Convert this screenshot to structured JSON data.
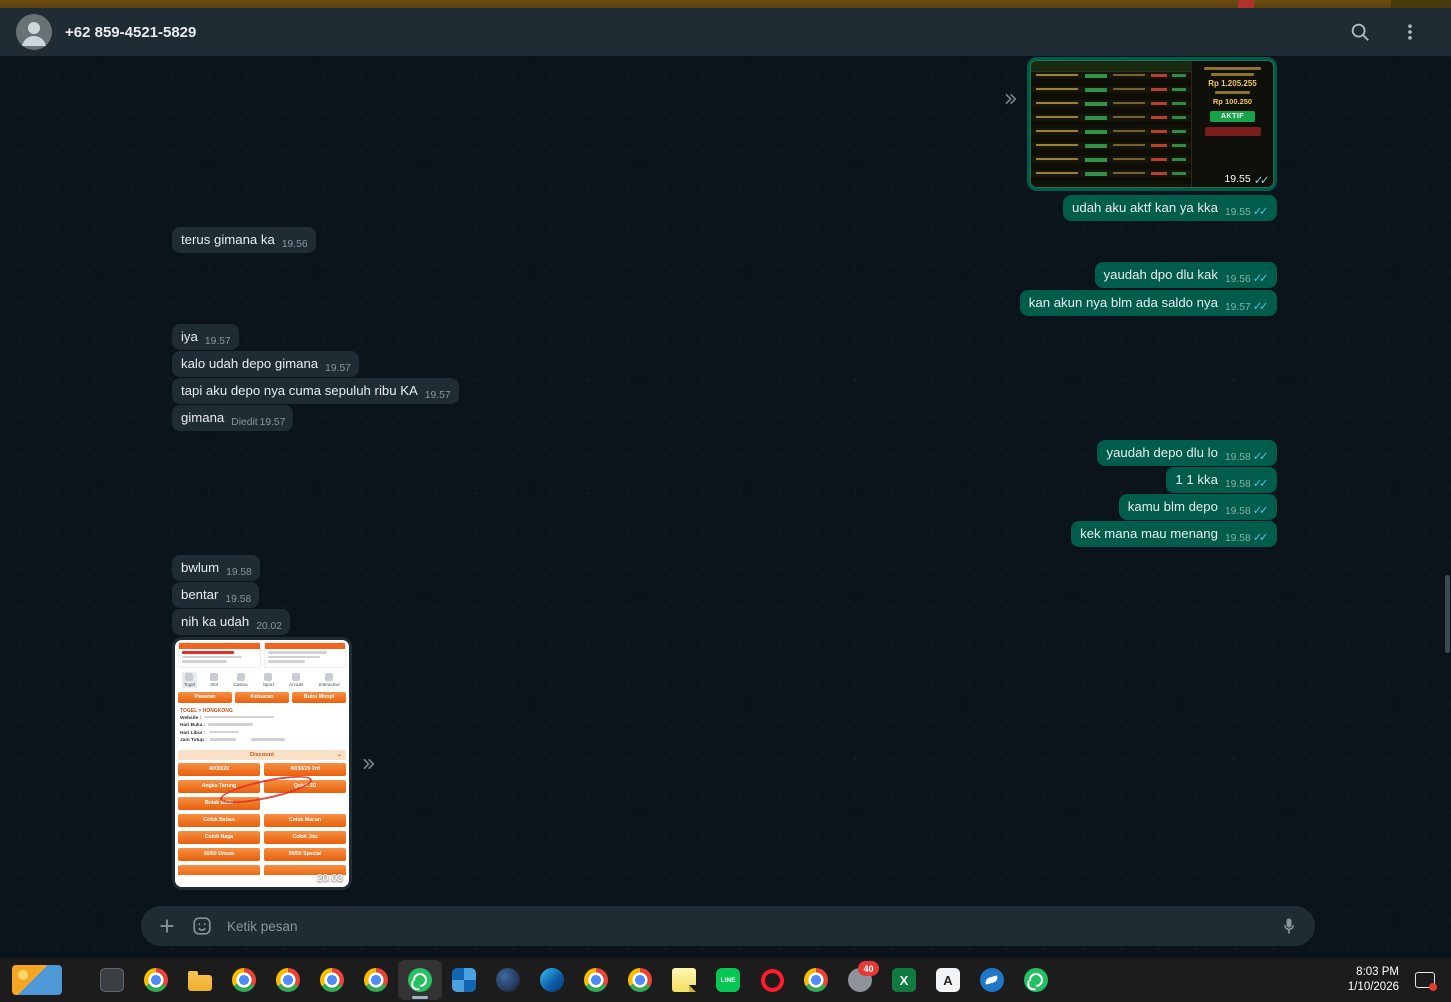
{
  "header": {
    "title": "+62 859-4521-5829"
  },
  "composer": {
    "placeholder": "Ketik pesan"
  },
  "chat": {
    "messages": [
      {
        "dir": "out",
        "type": "image",
        "time": "19.55"
      },
      {
        "dir": "out",
        "text": "udah aku aktf kan ya kka",
        "time": "19.55"
      },
      {
        "dir": "in",
        "text": "terus gimana ka",
        "time": "19.56"
      },
      {
        "dir": "out",
        "text": "yaudah dpo dlu kak",
        "time": "19.56"
      },
      {
        "dir": "out",
        "text": "kan akun nya blm ada saldo nya",
        "time": "19.57"
      },
      {
        "dir": "in",
        "text": "iya",
        "time": "19.57"
      },
      {
        "dir": "in",
        "text": "kalo udah depo gimana",
        "time": "19.57"
      },
      {
        "dir": "in",
        "text": "tapi aku depo nya cuma sepuluh ribu KA",
        "time": "19.57"
      },
      {
        "dir": "in",
        "text": "gimana",
        "edited": "Diedit",
        "time": "19.57"
      },
      {
        "dir": "out",
        "text": "yaudah depo dlu lo",
        "time": "19.58"
      },
      {
        "dir": "out",
        "text": "1 1 kka",
        "time": "19.58"
      },
      {
        "dir": "out",
        "text": "kamu blm depo",
        "time": "19.58"
      },
      {
        "dir": "out",
        "text": "kek mana mau menang",
        "time": "19.58"
      },
      {
        "dir": "in",
        "text": "bwlum",
        "time": "19.58"
      },
      {
        "dir": "in",
        "text": "bentar",
        "time": "19.58"
      },
      {
        "dir": "in",
        "text": "nih ka udah",
        "time": "20.02"
      },
      {
        "dir": "in",
        "type": "image",
        "time": "20.03"
      }
    ]
  },
  "outgoing_image": {
    "amount1": "Rp 1.205.255",
    "amount2": "Rp 100.250",
    "status": "AKTIF"
  },
  "incoming_image": {
    "breadcrumb": "TOGEL > HONGKONG",
    "nav": [
      "Togel",
      "Slot",
      "Casino",
      "Sport",
      "Arcade",
      "Interactive"
    ],
    "buttons": [
      "Pasaran",
      "Keluaran",
      "Buku Mimpi"
    ],
    "info": [
      "Website :",
      "Hari Buka :",
      "Hari Libur :",
      "Jam Tutup :"
    ],
    "discount_label": "Discount",
    "grid": [
      "40/30/20",
      "40/30/20 3rd",
      "Angka Tarung",
      "Quick 2D",
      "Bolak Balik",
      "",
      "Colok Bebas",
      "Colok Macan",
      "Colok Naga",
      "Colok Jitu",
      "50/50 Umum",
      "50/50 Special",
      "",
      ""
    ]
  },
  "taskbar": {
    "time": "8:03 PM",
    "date": "1/10/2026",
    "badge": "40",
    "excel_glyph": "X",
    "letter_glyph": "A",
    "line_glyph": "LINE"
  }
}
